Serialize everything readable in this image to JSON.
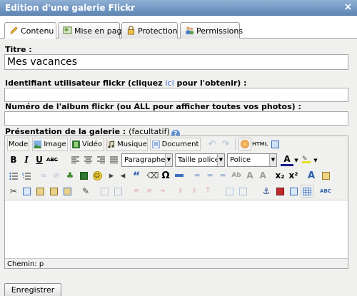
{
  "window": {
    "title": "Edition d'une galerie Flickr",
    "close_label": "×"
  },
  "tabs": [
    {
      "label": "Contenu",
      "icon": "pencil-icon",
      "active": true
    },
    {
      "label": "Mise en page",
      "icon": "layout-icon",
      "active": false
    },
    {
      "label": "Protection",
      "icon": "padlock-icon",
      "active": false
    },
    {
      "label": "Permissions",
      "icon": "users-icon",
      "active": false
    }
  ],
  "form": {
    "title_label": "Titre :",
    "title_value": "Mes vacances",
    "user_label_pre": "Identifiant utilisateur flickr (cliquez ",
    "user_label_link": "ici",
    "user_label_post": " pour l'obtenir) :",
    "user_value": "",
    "album_label": "Numéro de l'album flickr (ou ALL pour afficher toutes vos photos) :",
    "album_value": "",
    "desc_label": "Présentation de la galerie :",
    "desc_optional": "(facultatif)",
    "help_glyph": "?",
    "submit_label": "Enregistrer"
  },
  "editor": {
    "mode_label": "Mode",
    "image_label": "Image",
    "video_label": "Vidéo",
    "music_label": "Musique",
    "document_label": "Document",
    "html_label": "HTML",
    "format_select": "Paragraphe",
    "size_select": "Taille police",
    "font_select": "Police",
    "bold": "B",
    "italic": "I",
    "underline": "U",
    "strike": "ABC",
    "quote": "“",
    "omega": "Ω",
    "font_color": "A",
    "subscript": "x₂",
    "superscript": "x²",
    "abc_check": "ABC",
    "path_label": "Chemin: p"
  }
}
